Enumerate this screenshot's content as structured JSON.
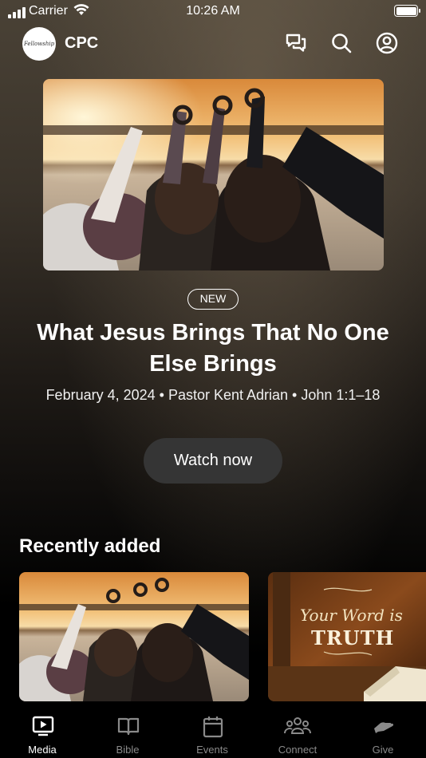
{
  "status_bar": {
    "carrier": "Carrier",
    "time": "10:26 AM"
  },
  "header": {
    "brand": "CPC",
    "logo_text": "Fellowship"
  },
  "hero": {
    "badge": "NEW",
    "title": "What Jesus Brings That No One Else Brings",
    "meta": "February 4, 2024 • Pastor Kent Adrian • John 1:1–18",
    "button_label": "Watch now"
  },
  "recent": {
    "title": "Recently added",
    "cards": [
      {
        "image": "friends-heart-hands-sunset"
      },
      {
        "image": "your-word-is-truth-bible",
        "overlay_line1": "Your Word is",
        "overlay_line2": "TRUTH"
      }
    ]
  },
  "tabs": [
    {
      "label": "Media",
      "icon": "media-icon",
      "active": true
    },
    {
      "label": "Bible",
      "icon": "book-icon",
      "active": false
    },
    {
      "label": "Events",
      "icon": "calendar-icon",
      "active": false
    },
    {
      "label": "Connect",
      "icon": "people-icon",
      "active": false
    },
    {
      "label": "Give",
      "icon": "hand-icon",
      "active": false
    }
  ],
  "colors": {
    "button_bg": "#353535",
    "inactive_tab": "#8a8a8a"
  }
}
